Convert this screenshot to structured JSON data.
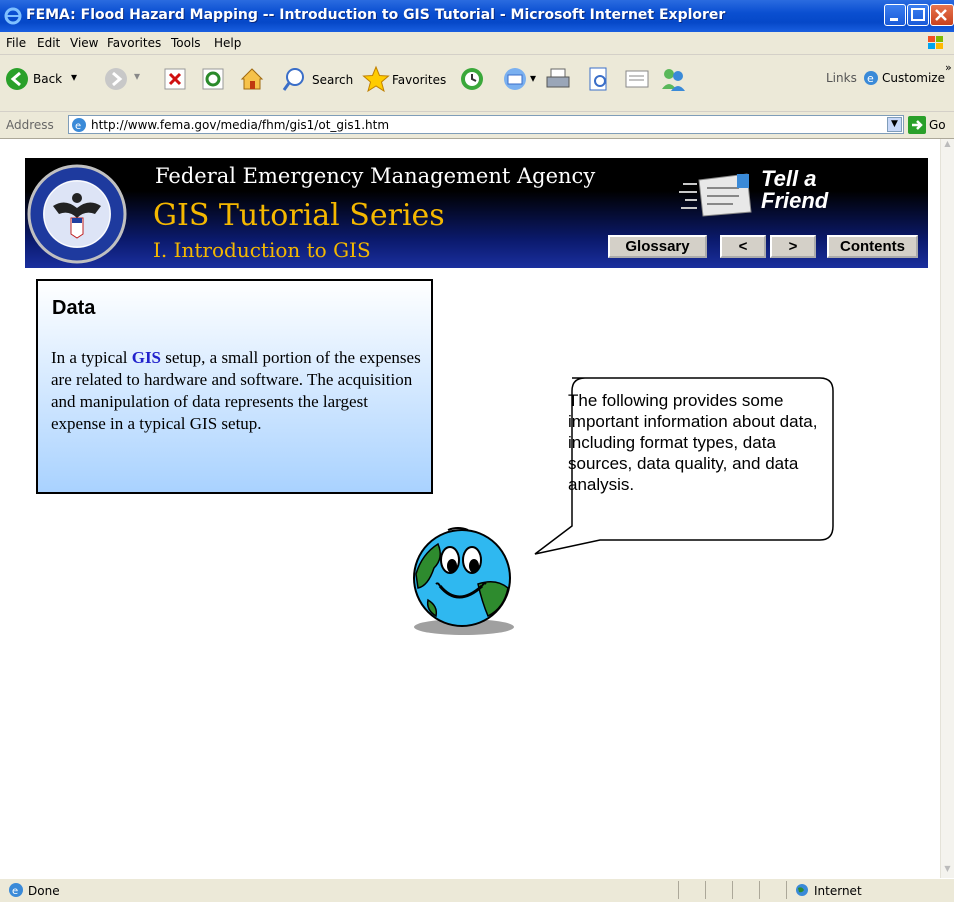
{
  "window": {
    "title": "FEMA: Flood Hazard Mapping -- Introduction to GIS Tutorial - Microsoft Internet Explorer"
  },
  "menu": {
    "items": [
      "File",
      "Edit",
      "View",
      "Favorites",
      "Tools",
      "Help"
    ]
  },
  "toolbar": {
    "back_label": "Back",
    "search_label": "Search",
    "favorites_label": "Favorites",
    "links_label": "Links",
    "customize_label": "Customize"
  },
  "address": {
    "label": "Address",
    "url": "http://www.fema.gov/media/fhm/gis1/ot_gis1.htm",
    "go_label": "Go"
  },
  "banner": {
    "agency": "Federal Emergency Management Agency",
    "series": "GIS Tutorial Series",
    "section": "I. Introduction to GIS",
    "tell_a_friend_line1": "Tell a",
    "tell_a_friend_line2": "Friend",
    "glossary_label": "Glossary",
    "prev_label": "<",
    "next_label": ">",
    "contents_label": "Contents"
  },
  "content": {
    "heading": "Data",
    "para_pre": "In a typical ",
    "para_link": "GIS",
    "para_post": " setup, a small portion of the expenses are related to hardware and software.  The acquisition and manipulation of data represents the largest expense in a typical GIS setup.",
    "bubble": "The following provides some important information about data, including format types, data sources, data quality, and data analysis."
  },
  "status": {
    "left": "Done",
    "zone": "Internet"
  },
  "colors": {
    "title_blue": "#0a4fd1",
    "banner_gold": "#f5b800",
    "box_gradient_end": "#a9d2ff",
    "globe_blue": "#2fb8f0",
    "globe_green": "#2e8b2e"
  }
}
